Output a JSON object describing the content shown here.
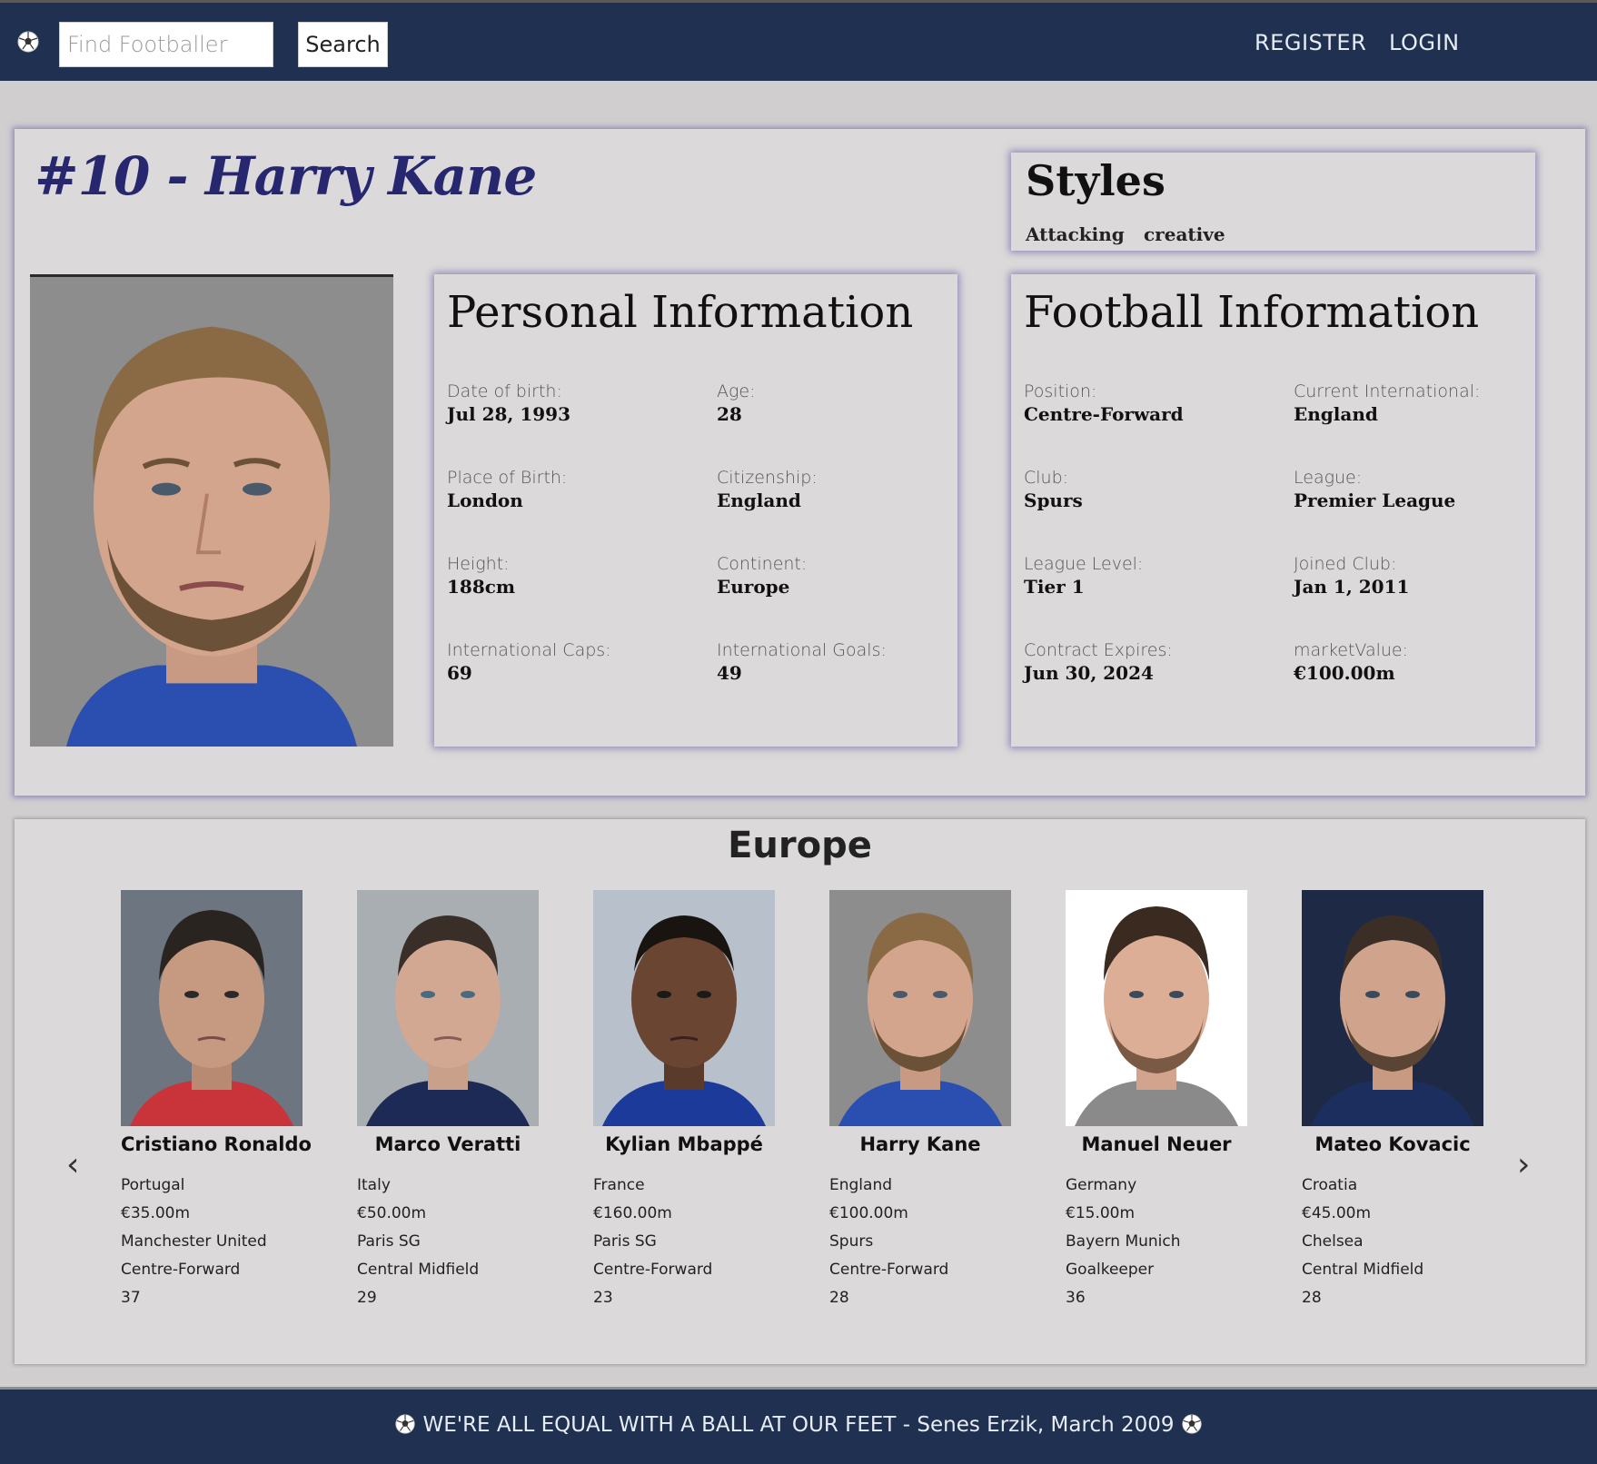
{
  "nav": {
    "search_placeholder": "Find Footballer",
    "search_label": "Search",
    "register": "REGISTER",
    "login": "LOGIN"
  },
  "player": {
    "title": "#10 - Harry Kane",
    "styles_title": "Styles",
    "styles": [
      "Attacking",
      "creative"
    ],
    "personal": {
      "title": "Personal Information",
      "fields": [
        {
          "label": "Date of birth:",
          "value": "Jul 28, 1993"
        },
        {
          "label": "Age:",
          "value": "28"
        },
        {
          "label": "Place of Birth:",
          "value": "London"
        },
        {
          "label": "Citizenship:",
          "value": "England"
        },
        {
          "label": "Height:",
          "value": "188cm"
        },
        {
          "label": "Continent:",
          "value": "Europe"
        },
        {
          "label": "International Caps:",
          "value": "69"
        },
        {
          "label": "International Goals:",
          "value": "49"
        }
      ]
    },
    "football": {
      "title": "Football Information",
      "fields": [
        {
          "label": "Position:",
          "value": "Centre-Forward"
        },
        {
          "label": "Current International:",
          "value": "England"
        },
        {
          "label": "Club:",
          "value": "Spurs"
        },
        {
          "label": "League:",
          "value": "Premier League"
        },
        {
          "label": "League Level:",
          "value": "Tier 1"
        },
        {
          "label": "Joined Club:",
          "value": "Jan 1, 2011"
        },
        {
          "label": "Contract Expires:",
          "value": "Jun 30, 2024"
        },
        {
          "label": "marketValue:",
          "value": "€100.00m"
        }
      ]
    }
  },
  "carousel": {
    "title": "Europe",
    "prev": "‹",
    "next": "›",
    "players": [
      {
        "name": "Cristiano Ronaldo",
        "country": "Portugal",
        "value": "€35.00m",
        "club": "Manchester United",
        "position": "Centre-Forward",
        "age": "37"
      },
      {
        "name": "Marco Veratti",
        "country": "Italy",
        "value": "€50.00m",
        "club": "Paris SG",
        "position": "Central Midfield",
        "age": "29"
      },
      {
        "name": "Kylian Mbappé",
        "country": "France",
        "value": "€160.00m",
        "club": "Paris SG",
        "position": "Centre-Forward",
        "age": "23"
      },
      {
        "name": "Harry Kane",
        "country": "England",
        "value": "€100.00m",
        "club": "Spurs",
        "position": "Centre-Forward",
        "age": "28"
      },
      {
        "name": "Manuel Neuer",
        "country": "Germany",
        "value": "€15.00m",
        "club": "Bayern Munich",
        "position": "Goalkeeper",
        "age": "36"
      },
      {
        "name": "Mateo Kovacic",
        "country": "Croatia",
        "value": "€45.00m",
        "club": "Chelsea",
        "position": "Central Midfield",
        "age": "28"
      }
    ]
  },
  "footer": {
    "quote": "WE'RE ALL EQUAL WITH A BALL AT OUR FEET - Senes Erzik, March 2009"
  },
  "colors": {
    "navy": "#1f3050",
    "title_blue": "#26276e",
    "card_bg": "#dcd9da",
    "page_bg": "#d0cecf"
  }
}
